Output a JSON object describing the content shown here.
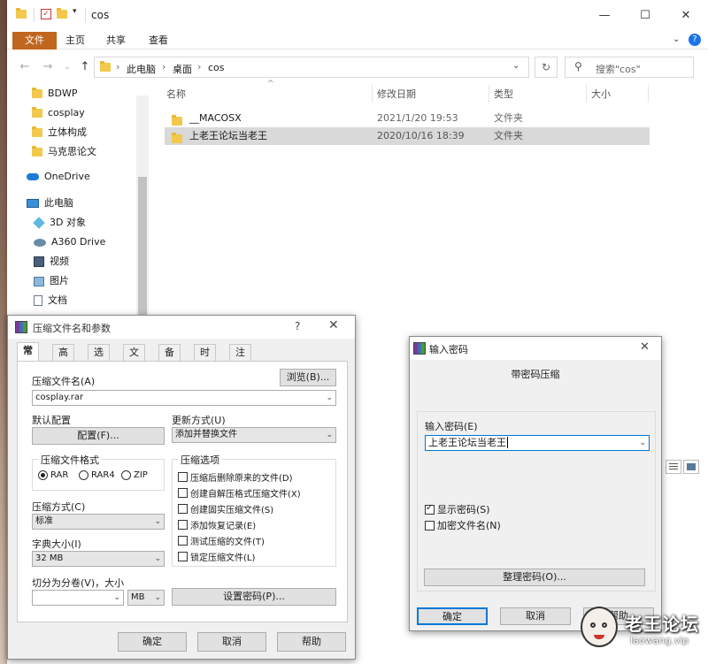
{
  "explorer": {
    "title": "cos",
    "ribbon_tabs": [
      "文件",
      "主页",
      "共享",
      "查看"
    ],
    "breadcrumb": [
      "此电脑",
      "桌面",
      "cos"
    ],
    "search_placeholder": "搜索\"cos\"",
    "sidebar": [
      {
        "label": "BDWP",
        "icon": "folder-icon"
      },
      {
        "label": "cosplay",
        "icon": "folder-icon"
      },
      {
        "label": "立体构成",
        "icon": "folder-icon"
      },
      {
        "label": "马克思论文",
        "icon": "folder-icon"
      },
      {
        "label": "OneDrive",
        "icon": "cloud-icon"
      },
      {
        "label": "此电脑",
        "icon": "computer-icon"
      },
      {
        "label": "3D 对象",
        "icon": "cube-icon"
      },
      {
        "label": "A360 Drive",
        "icon": "drive-icon"
      },
      {
        "label": "视频",
        "icon": "video-icon"
      },
      {
        "label": "图片",
        "icon": "picture-icon"
      },
      {
        "label": "文档",
        "icon": "document-icon"
      }
    ],
    "columns": [
      "名称",
      "修改日期",
      "类型",
      "大小"
    ],
    "files": [
      {
        "name": "__MACOSX",
        "date": "2021/1/20 19:53",
        "type": "文件夹",
        "size": ""
      },
      {
        "name": "上老王论坛当老王",
        "date": "2020/10/16 18:39",
        "type": "文件夹",
        "size": ""
      }
    ]
  },
  "rar": {
    "title": "压缩文件名和参数",
    "help": "?",
    "tabs": [
      "常规",
      "高级",
      "选项",
      "文件",
      "备份",
      "时间",
      "注释"
    ],
    "archive_label": "压缩文件名(A)",
    "browse": "浏览(B)...",
    "archive_value": "cosplay.rar",
    "default_config_label": "默认配置",
    "config_button": "配置(F)...",
    "update_label": "更新方式(U)",
    "update_value": "添加并替换文件",
    "format_label": "压缩文件格式",
    "formats": [
      "RAR",
      "RAR4",
      "ZIP"
    ],
    "options_label": "压缩选项",
    "options": [
      {
        "label": "压缩后删除原来的文件(D)",
        "checked": false
      },
      {
        "label": "创建自解压格式压缩文件(X)",
        "checked": false
      },
      {
        "label": "创建固实压缩文件(S)",
        "checked": false
      },
      {
        "label": "添加恢复记录(E)",
        "checked": false
      },
      {
        "label": "测试压缩的文件(T)",
        "checked": false
      },
      {
        "label": "锁定压缩文件(L)",
        "checked": false
      }
    ],
    "method_label": "压缩方式(C)",
    "method_value": "标准",
    "dict_label": "字典大小(I)",
    "dict_value": "32 MB",
    "split_label": "切分为分卷(V)，大小",
    "split_unit": "MB",
    "set_password": "设置密码(P)...",
    "ok": "确定",
    "cancel": "取消",
    "help_button": "帮助"
  },
  "pw": {
    "title": "输入密码",
    "heading": "带密码压缩",
    "input_label": "输入密码(E)",
    "input_value": "上老王论坛当老王",
    "show_password": "显示密码(S)",
    "encrypt_names": "加密文件名(N)",
    "organize": "整理密码(O)...",
    "ok": "确定",
    "cancel": "取消",
    "help": "帮助"
  },
  "watermark": {
    "text": "老王论坛",
    "url": "laowang.vip"
  }
}
